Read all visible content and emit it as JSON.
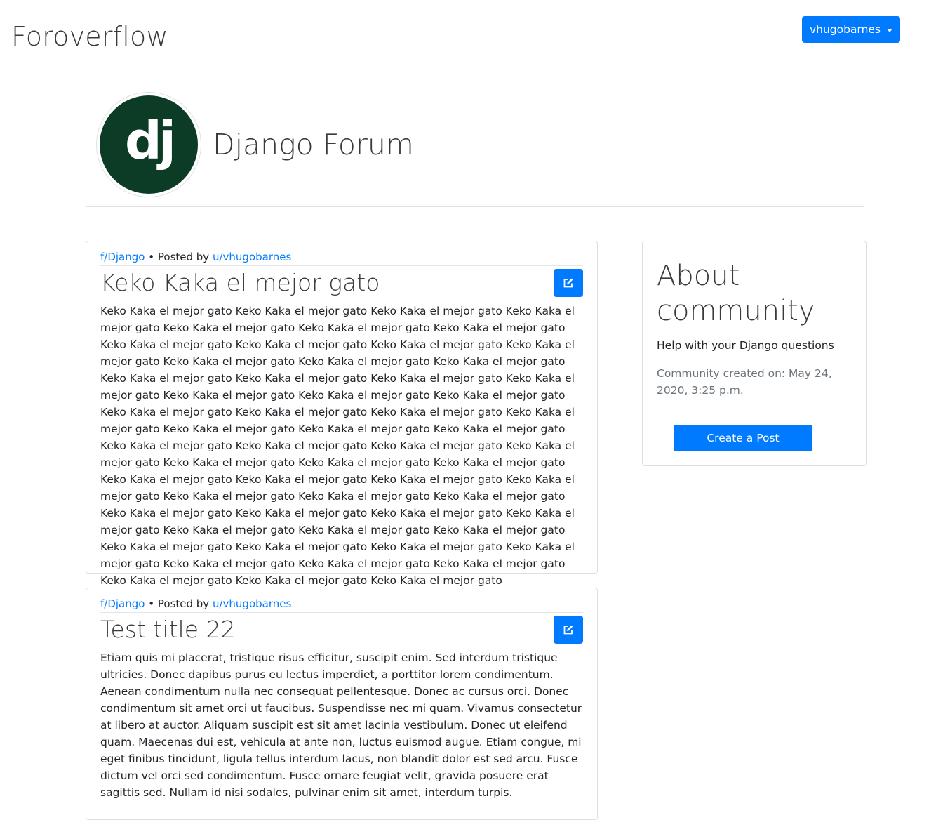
{
  "navbar": {
    "brand": "Foroverflow",
    "user_menu_label": "vhugobarnes"
  },
  "community": {
    "logo_text": "dj",
    "name": "Django Forum"
  },
  "posts": [
    {
      "community_link": "f/Django",
      "separator": "•",
      "posted_by_label": "Posted by",
      "author_link": "u/vhugobarnes",
      "title": "Keko Kaka el mejor gato",
      "body": "Keko Kaka el mejor gato Keko Kaka el mejor gato Keko Kaka el mejor gato Keko Kaka el mejor gato Keko Kaka el mejor gato Keko Kaka el mejor gato Keko Kaka el mejor gato Keko Kaka el mejor gato Keko Kaka el mejor gato Keko Kaka el mejor gato Keko Kaka el mejor gato Keko Kaka el mejor gato Keko Kaka el mejor gato Keko Kaka el mejor gato Keko Kaka el mejor gato Keko Kaka el mejor gato Keko Kaka el mejor gato Keko Kaka el mejor gato Keko Kaka el mejor gato Keko Kaka el mejor gato Keko Kaka el mejor gato Keko Kaka el mejor gato Keko Kaka el mejor gato Keko Kaka el mejor gato Keko Kaka el mejor gato Keko Kaka el mejor gato Keko Kaka el mejor gato Keko Kaka el mejor gato Keko Kaka el mejor gato Keko Kaka el mejor gato Keko Kaka el mejor gato Keko Kaka el mejor gato Keko Kaka el mejor gato Keko Kaka el mejor gato Keko Kaka el mejor gato Keko Kaka el mejor gato Keko Kaka el mejor gato Keko Kaka el mejor gato Keko Kaka el mejor gato Keko Kaka el mejor gato Keko Kaka el mejor gato Keko Kaka el mejor gato Keko Kaka el mejor gato Keko Kaka el mejor gato Keko Kaka el mejor gato Keko Kaka el mejor gato Keko Kaka el mejor gato Keko Kaka el mejor gato Keko Kaka el mejor gato Keko Kaka el mejor gato Keko Kaka el mejor gato Keko Kaka el mejor gato Keko Kaka el mejor gato Keko Kaka el mejor gato Keko Kaka el mejor gato Keko Kaka el mejor gato Keko Kaka el mejor gato Keko Kaka el mejor gato Keko Kaka el mejor gato"
    },
    {
      "community_link": "f/Django",
      "separator": "•",
      "posted_by_label": "Posted by",
      "author_link": "u/vhugobarnes",
      "title": "Test title 22",
      "body": "Etiam quis mi placerat, tristique risus efficitur, suscipit enim. Sed interdum tristique ultricies. Donec dapibus purus eu lectus imperdiet, a porttitor lorem condimentum. Aenean condimentum nulla nec consequat pellentesque. Donec ac cursus orci. Donec condimentum sit amet orci ut faucibus. Suspendisse nec mi quam. Vivamus consectetur at libero at auctor. Aliquam suscipit est sit amet lacinia vestibulum. Donec ut eleifend quam. Maecenas dui est, vehicula at ante non, luctus euismod augue. Etiam congue, mi eget finibus tincidunt, ligula tellus interdum lacus, non blandit dolor est sed arcu. Fusce dictum vel orci sed condimentum. Fusce ornare feugiat velit, gravida posuere erat sagittis sed. Nullam id nisi sodales, pulvinar enim sit amet, interdum turpis."
    }
  ],
  "about": {
    "title": "About community",
    "description": "Help with your Django questions",
    "created": "Community created on: May 24, 2020, 3:25 p.m.",
    "create_post_label": "Create a Post"
  },
  "icons": {
    "edit": "edit-icon",
    "dropdown": "caret-down-icon"
  },
  "colors": {
    "primary": "#007bff",
    "logo_background": "#0c3c26",
    "muted_text": "#6c757d"
  }
}
